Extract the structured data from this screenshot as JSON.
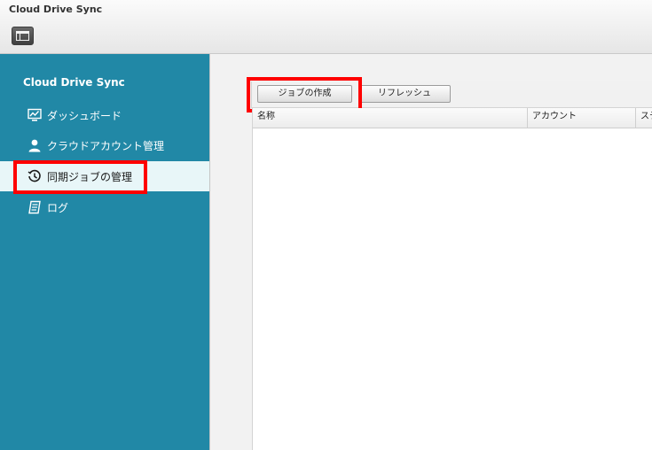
{
  "app": {
    "title": "Cloud Drive Sync"
  },
  "toolbar": {
    "layout_icon": "layout-icon"
  },
  "sidebar": {
    "title": "Cloud Drive Sync",
    "items": [
      {
        "label": "ダッシュボード",
        "icon": "dashboard-monitor-icon"
      },
      {
        "label": "クラウドアカウント管理",
        "icon": "user-icon"
      },
      {
        "label": "同期ジョブの管理",
        "icon": "history-clock-icon",
        "active": true
      },
      {
        "label": "ログ",
        "icon": "log-notes-icon"
      }
    ]
  },
  "jobs": {
    "create_label": "ジョブの作成",
    "refresh_label": "リフレッシュ",
    "columns": [
      "名称",
      "アカウント",
      "ステ"
    ]
  },
  "colors": {
    "sidebar_bg": "#2188a6",
    "active_item_bg": "#e8f6f8",
    "highlight": "#ff0000"
  }
}
